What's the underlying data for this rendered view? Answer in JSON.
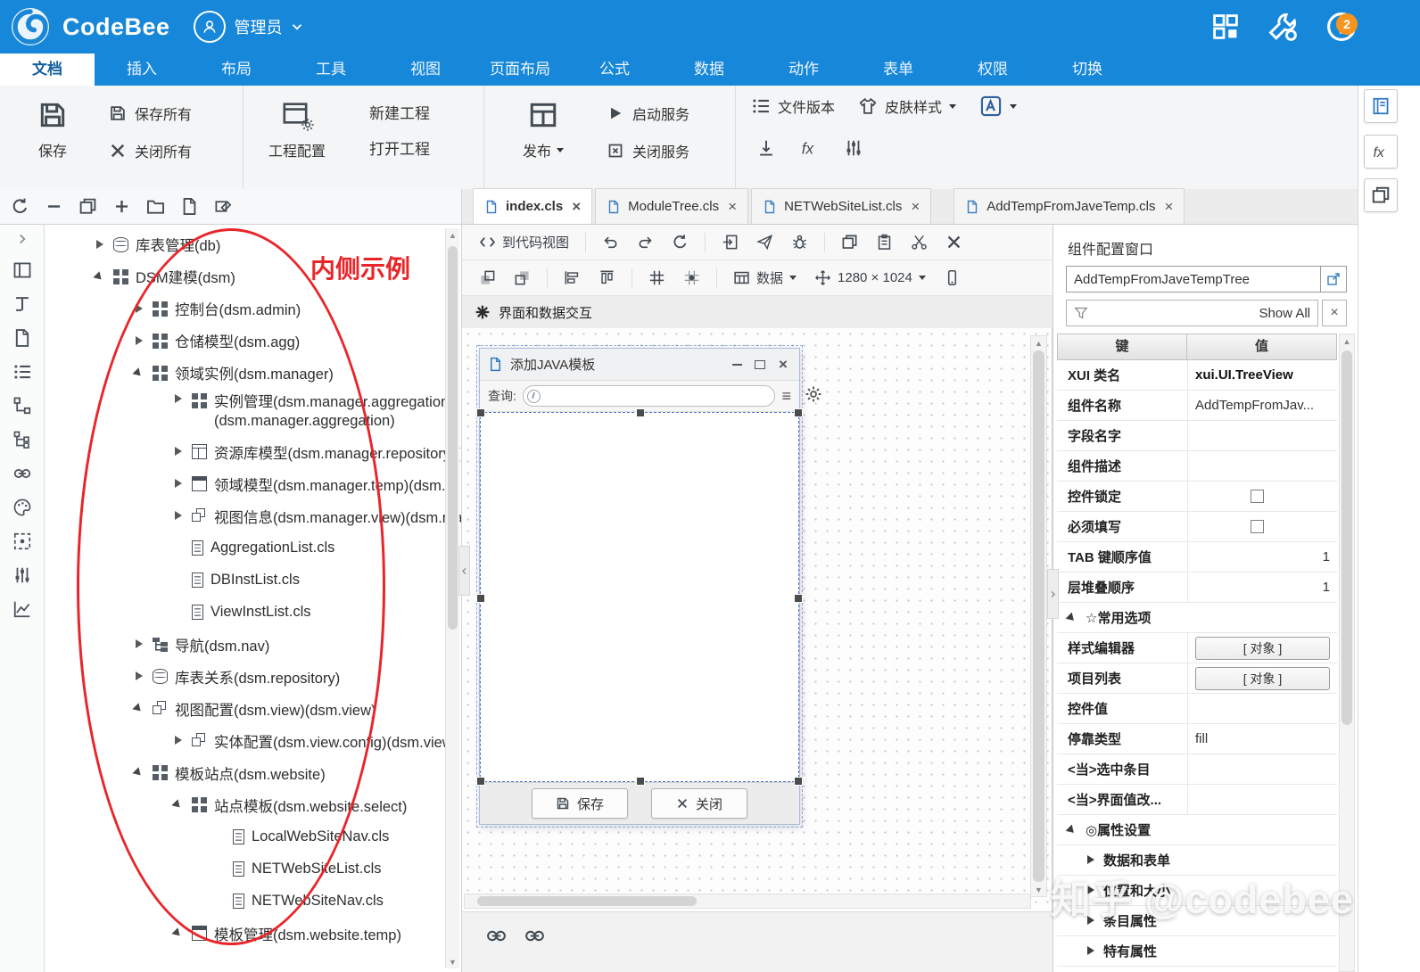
{
  "app": {
    "brand": "CodeBee",
    "user": "管理员",
    "badge_count": "2"
  },
  "icons": {
    "logo-icon": "blue swirl circle",
    "user-icon": "person in circle",
    "blocks-icon": "dashboard squares",
    "tools-icon": "wrench and gear",
    "info-icon": "i in circle",
    "save-icon": "floppy disk",
    "close-icon": "×",
    "expand-arrow": "▶ / ◢",
    "dropdown-caret": "▾",
    "filter-icon": "funnel",
    "external-link-icon": "box with arrow",
    "hamburger-icon": "≡",
    "gear-icon": "gear",
    "checkbox": "☐"
  },
  "menu_tabs": [
    {
      "label": "文档",
      "active": true
    },
    {
      "label": "插入"
    },
    {
      "label": "布局"
    },
    {
      "label": "工具"
    },
    {
      "label": "视图"
    },
    {
      "label": "页面布局"
    },
    {
      "label": "公式"
    },
    {
      "label": "数据"
    },
    {
      "label": "动作"
    },
    {
      "label": "表单"
    },
    {
      "label": "权限"
    },
    {
      "label": "切换"
    }
  ],
  "ribbon": {
    "save": "保存",
    "save_all": "保存所有",
    "close_all": "关闭所有",
    "project_config": "工程配置",
    "new_project": "新建工程",
    "open_project": "打开工程",
    "publish": "发布",
    "start_service": "启动服务",
    "stop_service": "关闭服务",
    "file_version": "文件版本",
    "skin_style": "皮肤样式",
    "fx": "fx"
  },
  "tree_panel": {
    "annotation": "内侧示例",
    "items": [
      {
        "indent": 0,
        "arrow": "right",
        "icon": "db",
        "label": "库表管理(db)"
      },
      {
        "indent": 0,
        "arrow": "down",
        "icon": "grid4",
        "label": "DSM建模(dsm)"
      },
      {
        "indent": 1,
        "arrow": "right",
        "icon": "grid4",
        "label": "控制台(dsm.admin)"
      },
      {
        "indent": 1,
        "arrow": "right",
        "icon": "grid4",
        "label": "仓储模型(dsm.agg)"
      },
      {
        "indent": 1,
        "arrow": "down",
        "icon": "grid4",
        "label": "领域实例(dsm.manager)"
      },
      {
        "indent": 2,
        "arrow": "right",
        "icon": "grid4",
        "label": "实例管理(dsm.manager.aggregation) (dsm.manager.aggregation)",
        "wrap": true
      },
      {
        "indent": 2,
        "arrow": "right",
        "icon": "table",
        "label": "资源库模型(dsm.manager.repository)("
      },
      {
        "indent": 2,
        "arrow": "right",
        "icon": "window",
        "label": "领域模型(dsm.manager.temp)(dsm.m"
      },
      {
        "indent": 2,
        "arrow": "right",
        "icon": "layers",
        "label": "视图信息(dsm.manager.view)(dsm.ma"
      },
      {
        "indent": 2,
        "arrow": "none",
        "icon": "doc",
        "label": "AggregationList.cls"
      },
      {
        "indent": 2,
        "arrow": "none",
        "icon": "doc",
        "label": "DBInstList.cls"
      },
      {
        "indent": 2,
        "arrow": "none",
        "icon": "doc",
        "label": "ViewInstList.cls"
      },
      {
        "indent": 1,
        "arrow": "right",
        "icon": "nav",
        "label": "导航(dsm.nav)"
      },
      {
        "indent": 1,
        "arrow": "right",
        "icon": "db",
        "label": "库表关系(dsm.repository)"
      },
      {
        "indent": 1,
        "arrow": "down",
        "icon": "layers",
        "label": "视图配置(dsm.view)(dsm.view)"
      },
      {
        "indent": 2,
        "arrow": "right",
        "icon": "layers",
        "label": "实体配置(dsm.view.config)(dsm.view."
      },
      {
        "indent": 1,
        "arrow": "down",
        "icon": "grid4",
        "label": "模板站点(dsm.website)"
      },
      {
        "indent": 2,
        "arrow": "down",
        "icon": "grid4",
        "label": "站点模板(dsm.website.select)"
      },
      {
        "indent": 3,
        "arrow": "none",
        "icon": "doc",
        "label": "LocalWebSiteNav.cls"
      },
      {
        "indent": 3,
        "arrow": "none",
        "icon": "doc",
        "label": "NETWebSiteList.cls"
      },
      {
        "indent": 3,
        "arrow": "none",
        "icon": "doc",
        "label": "NETWebSiteNav.cls"
      },
      {
        "indent": 2,
        "arrow": "down",
        "icon": "window",
        "label": "模板管理(dsm.website.temp)"
      }
    ]
  },
  "editor_tabs": [
    {
      "label": "index.cls",
      "active": true
    },
    {
      "label": "ModuleTree.cls"
    },
    {
      "label": "NETWebSiteList.cls"
    },
    {
      "label": "AddTempFromJaveTemp.cls"
    }
  ],
  "designer": {
    "to_code_view": "到代码视图",
    "data_menu": "数据",
    "resolution": "1280 × 1024",
    "interaction_bar": "界面和数据交互",
    "dialog": {
      "title": "添加JAVA模板",
      "query_label": "查询:",
      "save_btn": "保存",
      "close_btn": "关闭"
    }
  },
  "inspector": {
    "title": "组件配置窗口",
    "component_input": "AddTempFromJaveTempTree",
    "filter_text": "Show All",
    "col_key": "键",
    "col_value": "值",
    "rows": [
      {
        "type": "text",
        "key": "XUI 类名",
        "value": "xui.UI.TreeView",
        "strong": true
      },
      {
        "type": "text",
        "key": "组件名称",
        "value": "AddTempFromJav..."
      },
      {
        "type": "text",
        "key": "字段名字",
        "value": ""
      },
      {
        "type": "text",
        "key": "组件描述",
        "value": ""
      },
      {
        "type": "checkbox",
        "key": "控件锁定"
      },
      {
        "type": "checkbox",
        "key": "必须填写"
      },
      {
        "type": "text",
        "key": "TAB 键顺序值",
        "value": "1",
        "align": "right"
      },
      {
        "type": "text",
        "key": "层堆叠顺序",
        "value": "1",
        "align": "right"
      },
      {
        "type": "section",
        "key": "☆常用选项"
      },
      {
        "type": "button",
        "key": "样式编辑器",
        "value": "[ 对象 ]"
      },
      {
        "type": "button",
        "key": "项目列表",
        "value": "[ 对象 ]"
      },
      {
        "type": "text",
        "key": "控件值",
        "value": ""
      },
      {
        "type": "text",
        "key": "停靠类型",
        "value": "fill"
      },
      {
        "type": "text",
        "key": "<当>选中条目",
        "value": ""
      },
      {
        "type": "text",
        "key": "<当>界面值改...",
        "value": ""
      },
      {
        "type": "section",
        "key": "◎属性设置"
      },
      {
        "type": "subsection",
        "key": "数据和表单"
      },
      {
        "type": "subsection",
        "key": "位置和大小"
      },
      {
        "type": "subsection",
        "key": "条目属性"
      },
      {
        "type": "subsection",
        "key": "特有属性"
      }
    ]
  },
  "watermark": "知乎 @codebee"
}
